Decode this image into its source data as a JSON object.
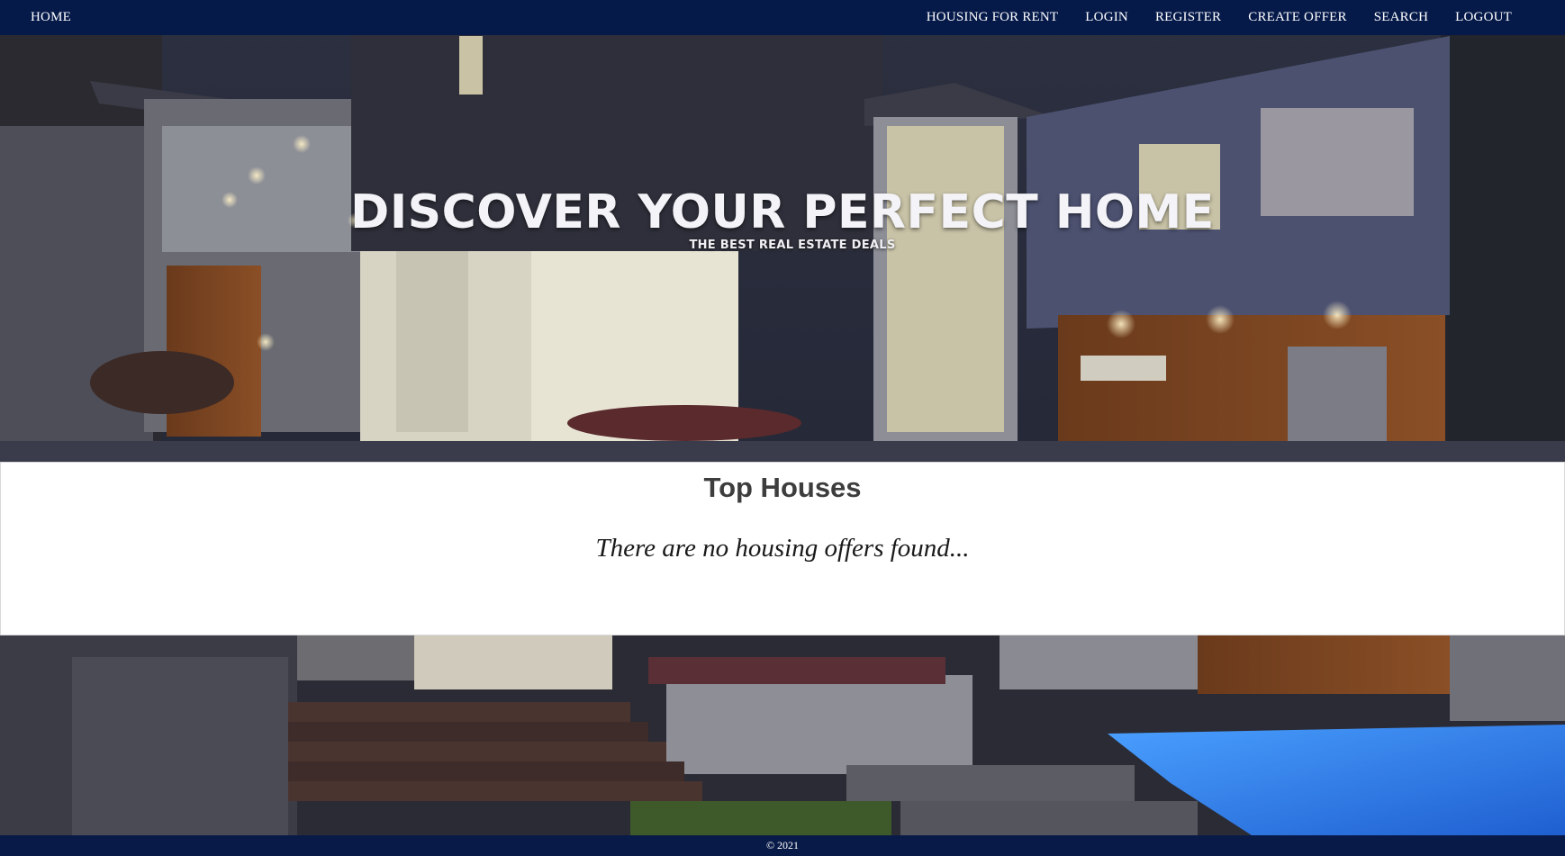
{
  "nav": {
    "home": "HOME",
    "items": [
      {
        "label": "HOUSING FOR RENT"
      },
      {
        "label": "LOGIN"
      },
      {
        "label": "REGISTER"
      },
      {
        "label": "CREATE OFFER"
      },
      {
        "label": "SEARCH"
      },
      {
        "label": "LOGOUT"
      }
    ]
  },
  "hero": {
    "title": "DISCOVER YOUR PERFECT HOME",
    "subtitle": "THE BEST REAL ESTATE DEALS"
  },
  "section": {
    "title": "Top Houses",
    "empty_message": "There are no housing offers found..."
  },
  "footer": {
    "text": "© 2021"
  },
  "colors": {
    "nav_bg": "#061a4a",
    "panel_bg": "#ffffff",
    "heading_text": "#3d3d3d"
  }
}
